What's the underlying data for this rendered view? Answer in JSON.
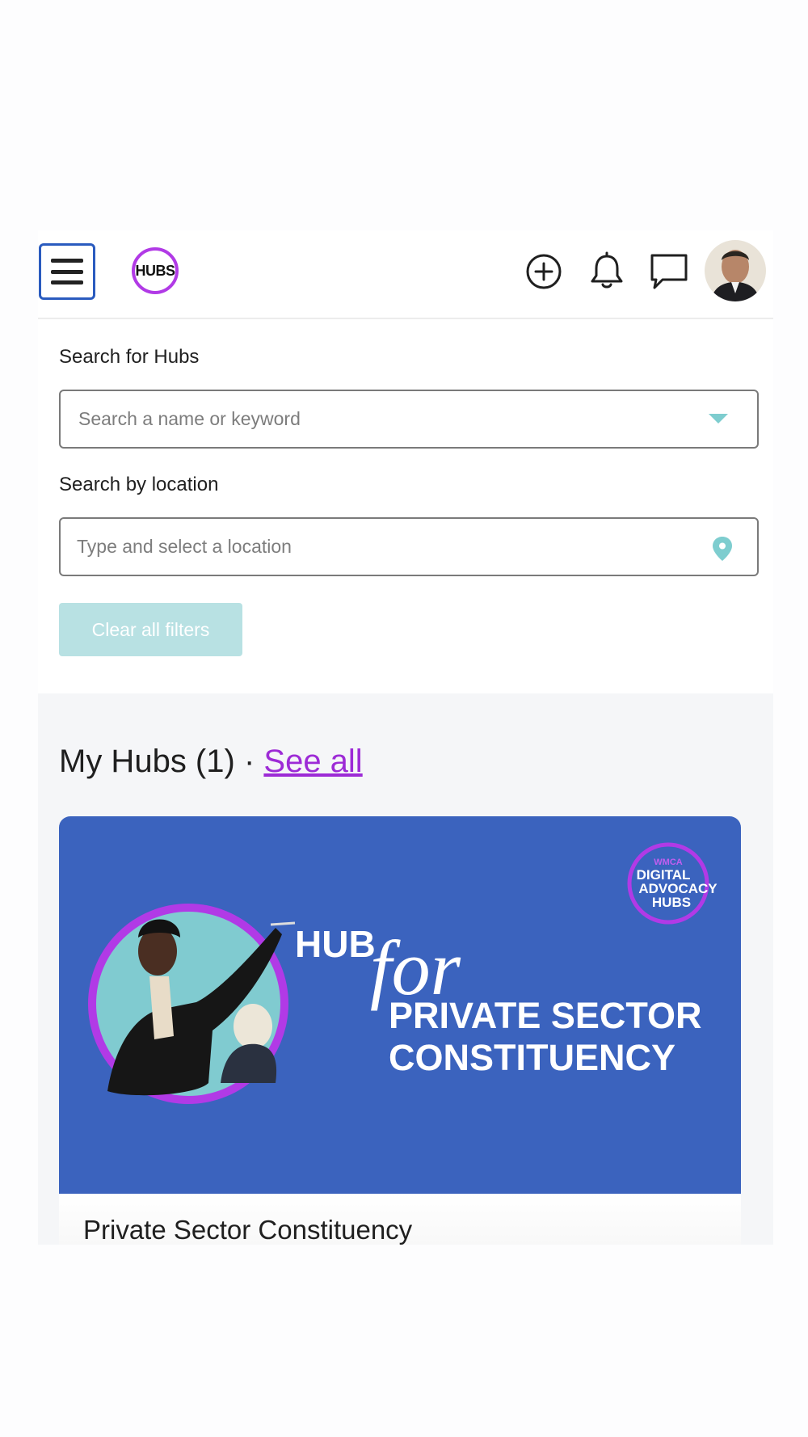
{
  "header": {
    "logo_text": "HUBS",
    "icons": [
      "menu-icon",
      "plus-circle-icon",
      "bell-icon",
      "chat-bubble-icon",
      "avatar"
    ]
  },
  "filters": {
    "hubs_label": "Search for Hubs",
    "hubs_placeholder": "Search a name or keyword",
    "location_label": "Search by location",
    "location_placeholder": "Type and select a location",
    "clear_label": "Clear all filters"
  },
  "my_hubs": {
    "title": "My Hubs (1)",
    "separator": "·",
    "see_all": "See all",
    "cards": [
      {
        "name": "Private Sector Constituency",
        "banner": {
          "hub": "HUB",
          "for": "for",
          "line1": "PRIVATE SECTOR",
          "line2": "CONSTITUENCY",
          "badge_top": "WMCA",
          "badge_line1": "DIGITAL",
          "badge_line2": "ADVOCACY",
          "badge_line3": "HUBS"
        }
      }
    ]
  },
  "colors": {
    "accent_purple": "#9d2bd6",
    "menu_border": "#2a5bbf",
    "banner_blue": "#3b63be",
    "teal": "#7ecdcf",
    "clear_button_bg": "#b8e1e3"
  }
}
